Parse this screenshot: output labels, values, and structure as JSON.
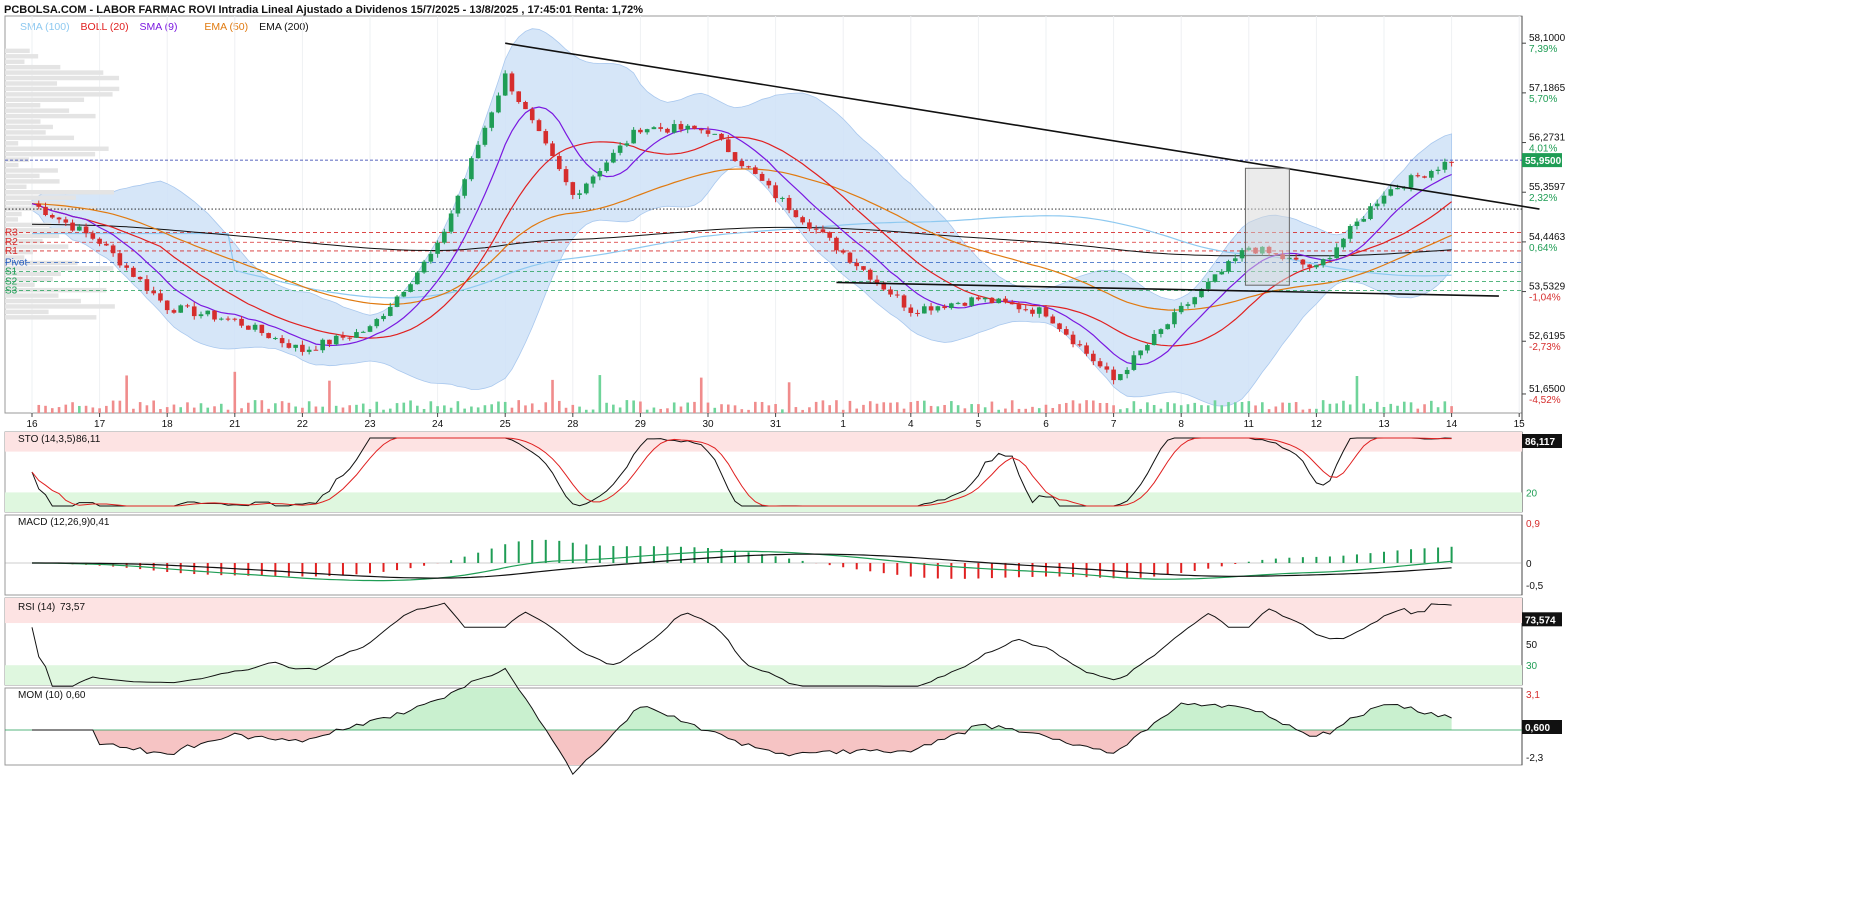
{
  "header": {
    "title": "PCBOLSA.COM - LABOR FARMAC ROVI Intradia Lineal Ajustado a Dividenos 15/7/2025 - 13/8/2025 , 17:45:01 Renta: 1,72%"
  },
  "legend": [
    {
      "label": "SMA (100)",
      "color": "#8ec9f0"
    },
    {
      "label": "BOLL (20)",
      "color": "#e02020"
    },
    {
      "label": "SMA (9)",
      "color": "#7a18e0"
    },
    {
      "label": "EMA (50)",
      "color": "#e07a10"
    },
    {
      "label": "EMA (200)",
      "color": "#111111"
    }
  ],
  "colors": {
    "up": "#1f9d55",
    "down": "#d62d2d",
    "boll_fill": "#cfe2f7",
    "current_price_bg": "#1f9d55",
    "up_volume": "#6fd49a",
    "down_volume": "#f08c8c",
    "overbought_band": "#fde3e3",
    "oversold_band": "#dff7df"
  },
  "price_axis": {
    "ticks": [
      {
        "price": "58,1000",
        "pct": "7,39%",
        "value": 58.1
      },
      {
        "price": "57,1865",
        "pct": "5,70%",
        "value": 57.1865
      },
      {
        "price": "56,2731",
        "pct": "4,01%",
        "value": 56.2731
      },
      {
        "price": "55,3597",
        "pct": "2,32%",
        "value": 55.3597
      },
      {
        "price": "54,4463",
        "pct": "0,64%",
        "value": 54.4463
      },
      {
        "price": "53,5329",
        "pct": "-1,04%",
        "value": 53.5329
      },
      {
        "price": "52,6195",
        "pct": "-2,73%",
        "value": 52.6195
      },
      {
        "price": "51,6500",
        "pct": "-4,52%",
        "value": 51.65
      }
    ],
    "current": "55,9500",
    "current_value": 55.95
  },
  "pivot_levels": [
    {
      "label": "R3",
      "value": 54.62,
      "color": "#d62d2d"
    },
    {
      "label": "R2",
      "value": 54.44,
      "color": "#d62d2d"
    },
    {
      "label": "R1",
      "value": 54.28,
      "color": "#d62d2d"
    },
    {
      "label": "Pivot",
      "value": 54.07,
      "color": "#2a5fbf"
    },
    {
      "label": "S1",
      "value": 53.9,
      "color": "#1f9d55"
    },
    {
      "label": "S2",
      "value": 53.72,
      "color": "#1f9d55"
    },
    {
      "label": "S3",
      "value": 53.55,
      "color": "#1f9d55"
    }
  ],
  "x_axis": {
    "labels": [
      "16",
      "17",
      "18",
      "21",
      "22",
      "23",
      "24",
      "25",
      "28",
      "29",
      "30",
      "31",
      "1",
      "4",
      "5",
      "6",
      "7",
      "8",
      "11",
      "12",
      "13",
      "14",
      "15"
    ]
  },
  "indicators": {
    "sto": {
      "label": "STO (14,3,5)",
      "value": "86,11",
      "axis_value": "86,117",
      "levels": [
        "80",
        "20"
      ]
    },
    "macd": {
      "label": "MACD (12,26,9)",
      "value": "0,41",
      "ticks": [
        "0,9",
        "0",
        "-0,5"
      ]
    },
    "rsi": {
      "label": "RSI (14)",
      "value": "73,57",
      "axis_value": "73,574",
      "levels": [
        "70",
        "50",
        "30"
      ]
    },
    "mom": {
      "label": "MOM (10)",
      "value": "0,60",
      "axis_value": "0,600",
      "ticks": [
        "3,1",
        "0",
        "-2,3"
      ]
    }
  },
  "chart_data": {
    "type": "candlestick",
    "title": "PCBOLSA.COM - LABOR FARMAC ROVI Intradia Lineal Ajustado a Dividenos 15/7/2025 - 13/8/2025 , 17:45:01 Renta: 1,72%",
    "x": [
      "16",
      "17",
      "18",
      "21",
      "22",
      "23",
      "24",
      "25",
      "28",
      "29",
      "30",
      "31",
      "1",
      "4",
      "5",
      "6",
      "7",
      "8",
      "11",
      "12",
      "13",
      "14"
    ],
    "close_path": [
      [
        0,
        55.15
      ],
      [
        1,
        54.45
      ],
      [
        2,
        53.25
      ],
      [
        3,
        53.0
      ],
      [
        4,
        52.45
      ],
      [
        5,
        52.85
      ],
      [
        6,
        54.35
      ],
      [
        7,
        57.5
      ],
      [
        8,
        55.3
      ],
      [
        9,
        56.55
      ],
      [
        10,
        56.5
      ],
      [
        11,
        55.3
      ],
      [
        12,
        54.25
      ],
      [
        13,
        53.2
      ],
      [
        14,
        53.4
      ],
      [
        15,
        53.15
      ],
      [
        16,
        51.9
      ],
      [
        17,
        53.2
      ],
      [
        18,
        54.35
      ],
      [
        19,
        53.95
      ],
      [
        20,
        55.35
      ],
      [
        21,
        55.95
      ]
    ],
    "ylim": [
      51.3,
      58.6
    ],
    "current_price": 55.95,
    "trendlines": [
      {
        "from": [
          7.0,
          58.1
        ],
        "to": [
          22.3,
          55.05
        ],
        "color": "#111"
      },
      {
        "from": [
          11.9,
          53.7
        ],
        "to": [
          21.7,
          53.45
        ],
        "color": "#111"
      }
    ]
  }
}
